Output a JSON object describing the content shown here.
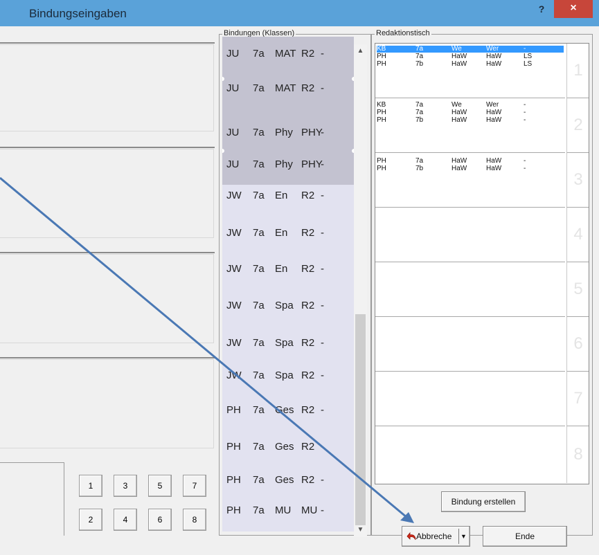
{
  "window": {
    "title": "Bindungseingaben",
    "help_label": "?",
    "close_label": "×"
  },
  "bindungen": {
    "group_label": "Bindungen (Klassen)",
    "rows": [
      [
        "JU",
        "7a",
        "MAT",
        "R2",
        "-"
      ],
      [
        "JU",
        "7a",
        "MAT",
        "R2",
        "-"
      ],
      [
        "JU",
        "7a",
        "Phy",
        "PHY",
        "-"
      ],
      [
        "JU",
        "7a",
        "Phy",
        "PHY",
        "-"
      ],
      [
        "JW",
        "7a",
        "En",
        "R2",
        "-"
      ],
      [
        "JW",
        "7a",
        "En",
        "R2",
        "-"
      ],
      [
        "JW",
        "7a",
        "En",
        "R2",
        "-"
      ],
      [
        "JW",
        "7a",
        "Spa",
        "R2",
        "-"
      ],
      [
        "JW",
        "7a",
        "Spa",
        "R2",
        "-"
      ],
      [
        "JW",
        "7a",
        "Spa",
        "R2",
        "-"
      ],
      [
        "PH",
        "7a",
        "Ges",
        "R2",
        "-"
      ],
      [
        "PH",
        "7a",
        "Ges",
        "R2",
        "-"
      ],
      [
        "PH",
        "7a",
        "Ges",
        "R2",
        "-"
      ],
      [
        "PH",
        "7a",
        "MU",
        "MU",
        "-"
      ]
    ]
  },
  "redaktionstisch": {
    "group_label": "Redaktionstisch",
    "slots": [
      {
        "number": "1",
        "rows": [
          [
            "KB",
            "7a",
            "We",
            "Wer",
            "-"
          ],
          [
            "PH",
            "7a",
            "HaW",
            "HaW",
            "LS"
          ],
          [
            "PH",
            "7b",
            "HaW",
            "HaW",
            "LS"
          ]
        ]
      },
      {
        "number": "2",
        "rows": [
          [
            "KB",
            "7a",
            "We",
            "Wer",
            "-"
          ],
          [
            "PH",
            "7a",
            "HaW",
            "HaW",
            "-"
          ],
          [
            "PH",
            "7b",
            "HaW",
            "HaW",
            "-"
          ]
        ]
      },
      {
        "number": "3",
        "rows": [
          [
            "PH",
            "7a",
            "HaW",
            "HaW",
            "-"
          ],
          [
            "PH",
            "7b",
            "HaW",
            "HaW",
            "-"
          ]
        ]
      },
      {
        "number": "4",
        "rows": []
      },
      {
        "number": "5",
        "rows": []
      },
      {
        "number": "6",
        "rows": []
      },
      {
        "number": "7",
        "rows": []
      },
      {
        "number": "8",
        "rows": []
      }
    ]
  },
  "number_buttons": [
    "1",
    "3",
    "5",
    "7",
    "2",
    "4",
    "6",
    "8"
  ],
  "buttons": {
    "create": "Bindung erstellen",
    "cancel": "Abbreche",
    "end": "Ende"
  },
  "colors": {
    "titlebar": "#5aa2d9",
    "close": "#c7463a",
    "selection": "#3399ff",
    "arrow": "#4a78b4"
  }
}
